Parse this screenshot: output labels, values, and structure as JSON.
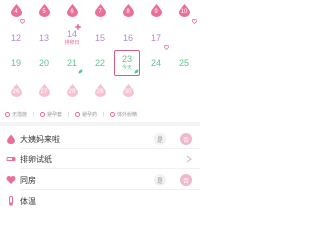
{
  "calendar": {
    "week1": {
      "d1": "4",
      "d2": "5",
      "d3": "6",
      "d4": "7",
      "d5": "8",
      "d6": "9",
      "d7": "10"
    },
    "week2": {
      "d1": "12",
      "d2": "13",
      "d3": "14",
      "d4": "15",
      "d5": "16",
      "d6": "17",
      "d3_sub": "排卵日"
    },
    "week3": {
      "d1": "19",
      "d2": "20",
      "d3": "21",
      "d4": "22",
      "d5": "23",
      "d6": "24",
      "d7": "25",
      "d5_sub": "今天"
    },
    "week4": {
      "d1": "26",
      "d2": "27",
      "d3": "28",
      "d4": "29",
      "d5": "30"
    },
    "colors": {
      "pink": "#e96a97",
      "purple": "#b38ad6",
      "green": "#63c28e",
      "selected_border": "#d8607d"
    },
    "icons": {
      "drop": "drop-icon",
      "heart": "heart-icon",
      "flower": "flower-icon",
      "leaf": "leaf-icon"
    }
  },
  "legend": {
    "items": [
      {
        "label": "无措施"
      },
      {
        "label": "避孕套"
      },
      {
        "label": "避孕药"
      },
      {
        "label": "体外射精"
      }
    ]
  },
  "records": {
    "period": {
      "label": "大姨妈来啦",
      "yes": "是",
      "no": "否"
    },
    "ovulation_test": {
      "label": "排卵试纸"
    },
    "intimacy": {
      "label": "同房",
      "yes": "是",
      "no": "否"
    },
    "partial": {
      "label": "体温"
    }
  }
}
